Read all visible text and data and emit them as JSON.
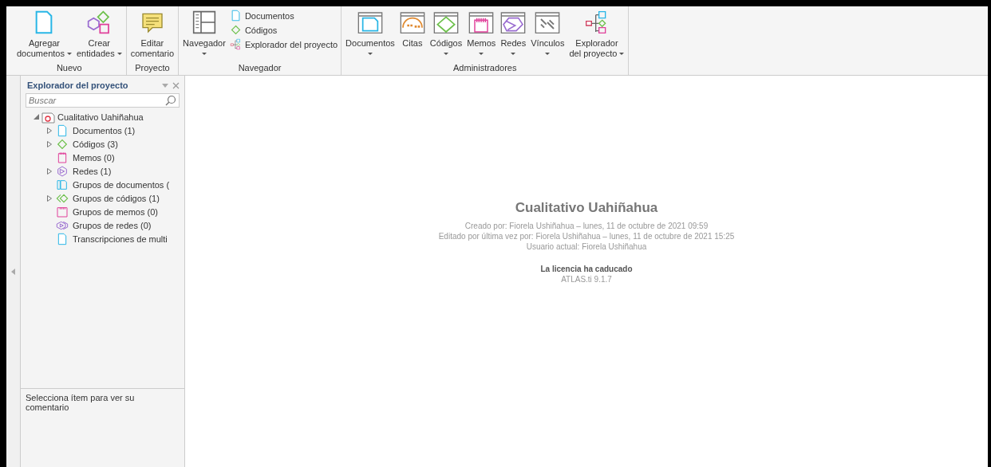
{
  "ribbon": {
    "groups": [
      {
        "label": "Nuevo",
        "buttons": [
          {
            "kind": "document",
            "lines": [
              "Agregar",
              "documentos"
            ],
            "dropdown": true
          },
          {
            "kind": "entities",
            "lines": [
              "Crear",
              "entidades"
            ],
            "dropdown": true
          }
        ]
      },
      {
        "label": "Proyecto",
        "buttons": [
          {
            "kind": "comment",
            "lines": [
              "Editar",
              "comentario"
            ],
            "dropdown": false
          }
        ]
      },
      {
        "label": "Navegador",
        "buttons": [
          {
            "kind": "navigator",
            "lines": [
              "Navegador"
            ],
            "dropdown": true
          }
        ],
        "small_buttons": [
          {
            "kind": "document",
            "label": "Documentos"
          },
          {
            "kind": "code",
            "label": "Códigos"
          },
          {
            "kind": "explorer",
            "label": "Explorador del proyecto"
          }
        ]
      },
      {
        "label": "Administradores",
        "buttons": [
          {
            "kind": "mgr-document",
            "lines": [
              "Documentos"
            ],
            "dropdown": true
          },
          {
            "kind": "mgr-quote",
            "lines": [
              "Citas"
            ],
            "dropdown": false
          },
          {
            "kind": "mgr-code",
            "lines": [
              "Códigos"
            ],
            "dropdown": true
          },
          {
            "kind": "mgr-memo",
            "lines": [
              "Memos"
            ],
            "dropdown": true
          },
          {
            "kind": "mgr-network",
            "lines": [
              "Redes"
            ],
            "dropdown": true
          },
          {
            "kind": "mgr-link",
            "lines": [
              "Vínculos"
            ],
            "dropdown": true
          },
          {
            "kind": "explorer",
            "lines": [
              "Explorador",
              "del proyecto"
            ],
            "dropdown": true
          }
        ]
      }
    ]
  },
  "sidebar": {
    "title": "Explorador del proyecto",
    "search": {
      "placeholder": "Buscar"
    },
    "tree": {
      "label": "Cualitativo Uahiñahua",
      "expanded": true,
      "children": [
        {
          "kind": "document",
          "label": "Documentos (1)",
          "expandable": true
        },
        {
          "kind": "code",
          "label": "Códigos (3)",
          "expandable": true
        },
        {
          "kind": "memo",
          "label": "Memos (0)",
          "expandable": false
        },
        {
          "kind": "network",
          "label": "Redes (1)",
          "expandable": true
        },
        {
          "kind": "docgroup",
          "label": "Grupos de documentos (",
          "expandable": false
        },
        {
          "kind": "codegroup",
          "label": "Grupos de códigos (1)",
          "expandable": true
        },
        {
          "kind": "memogroup",
          "label": "Grupos de memos (0)",
          "expandable": false
        },
        {
          "kind": "netgroup",
          "label": "Grupos de redes (0)",
          "expandable": false
        },
        {
          "kind": "document",
          "label": "Transcripciones de multi",
          "expandable": false
        }
      ]
    },
    "comment": "Selecciona ítem para ver su comentario"
  },
  "main": {
    "title": "Cualitativo Uahiñahua",
    "details": [
      "Creado por: Fiorela Ushiñahua – lunes, 11 de octubre de 2021 09:59",
      "Editado por última vez por: Fiorela Ushiñahua – lunes, 11 de octubre de 2021 15:25",
      "Usuario actual: Fiorela Ushiñahua"
    ],
    "license": "La licencia ha caducado",
    "version": "ATLAS.ti 9.1.7"
  }
}
